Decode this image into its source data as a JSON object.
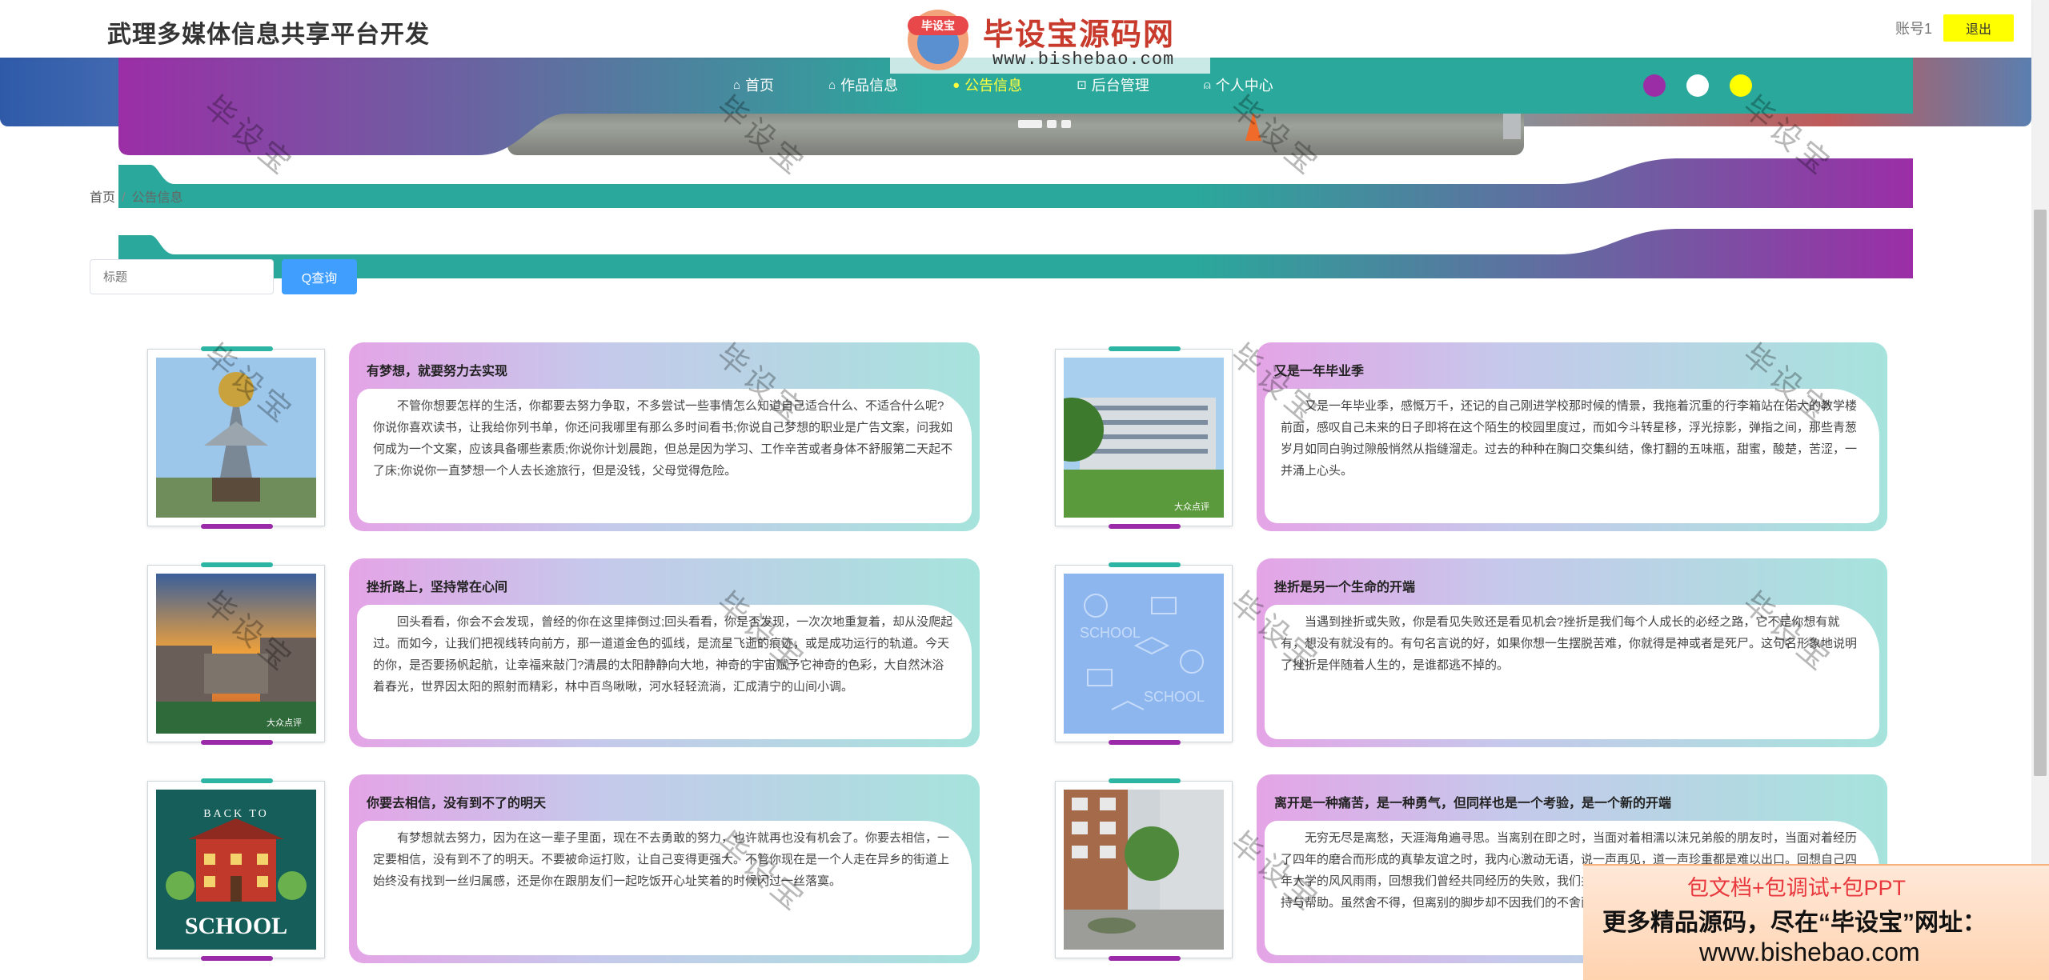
{
  "header": {
    "title": "武理多媒体信息共享平台开发",
    "account": "账号1",
    "logout": "退出"
  },
  "nav": {
    "items": [
      {
        "icon": "⌂",
        "label": "首页",
        "active": false
      },
      {
        "icon": "⌂",
        "label": "作品信息",
        "active": false
      },
      {
        "icon": "●",
        "label": "公告信息",
        "active": true
      },
      {
        "icon": "⊡",
        "label": "后台管理",
        "active": false
      },
      {
        "icon": "⍝",
        "label": "个人中心",
        "active": false
      }
    ],
    "theme_colors": [
      "#9b2ea6",
      "#ffffff",
      "#ffff00"
    ]
  },
  "logo": {
    "badge": "毕设宝",
    "text": "毕设宝源码网",
    "url": "www.bishebao.com"
  },
  "breadcrumb": {
    "home": "首页",
    "sep": "/",
    "current": "公告信息"
  },
  "search": {
    "placeholder": "标题",
    "button": "Q查询"
  },
  "watermark": "毕设宝",
  "cards": [
    {
      "title": "有梦想，就要努力去实现",
      "body": "不管你想要怎样的生活，你都要去努力争取，不多尝试一些事情怎么知道自己适合什么、不适合什么呢?你说你喜欢读书，让我给你列书单，你还问我哪里有那么多时间看书;你说自己梦想的职业是广告文案，问我如何成为一个文案，应该具备哪些素质;你说你计划晨跑，但总是因为学习、工作辛苦或者身体不舒服第二天起不了床;你说你一直梦想一个人去长途旅行，但是没钱，父母觉得危险。"
    },
    {
      "title": "又是一年毕业季",
      "body": "又是一年毕业季，感慨万千，还记的自己刚进学校那时候的情景，我拖着沉重的行李箱站在偌大的教学楼前面，感叹自己未来的日子即将在这个陌生的校园里度过，而如今斗转星移，浮光掠影，弹指之间，那些青葱岁月如同白驹过隙般悄然从指缝溜走。过去的种种在胸口交集纠结，像打翻的五味瓶，甜蜜，酸楚，苦涩，一并涌上心头。"
    },
    {
      "title": "挫折路上，坚持常在心间",
      "body": "回头看看，你会不会发现，曾经的你在这里摔倒过;回头看看，你是否发现，一次次地重复着，却从没爬起过。而如今，让我们把视线转向前方，那一道道金色的弧线，是流星飞逝的痕迹，或是成功运行的轨道。今天的你，是否要扬帆起航，让幸福来敲门?清晨的太阳静静向大地，神奇的宇宙赋予它神奇的色彩，大自然沐浴着春光，世界因太阳的照射而精彩，林中百鸟啾啾，河水轻轻流淌，汇成清宁的山间小调。"
    },
    {
      "title": "挫折是另一个生命的开端",
      "body": "当遇到挫折或失败，你是看见失败还是看见机会?挫折是我们每个人成长的必经之路，它不是你想有就有，想没有就没有的。有句名言说的好，如果你想一生摆脱苦难，你就得是神或者是死尸。这句名形象地说明了挫折是伴随着人生的，是谁都逃不掉的。"
    },
    {
      "title": "你要去相信，没有到不了的明天",
      "body": "有梦想就去努力，因为在这一辈子里面，现在不去勇敢的努力，也许就再也没有机会了。你要去相信，一定要相信，没有到不了的明天。不要被命运打败，让自己变得更强大。不管你现在是一个人走在异乡的街道上始终没有找到一丝归属感，还是你在跟朋友们一起吃饭开心址笑着的时候闪过一丝落寞。"
    },
    {
      "title": "离开是一种痛苦，是一种勇气，但同样也是一个考验，是一个新的开端",
      "body": "无穷无尽是离愁，天涯海角遍寻思。当离别在即之时，当面对着相濡以沫兄弟般的朋友时，当面对着经历了四年的磨合而形成的真挚友谊之时，我内心激动无语，说一声再见，道一声珍重都是难以出口。回想自己四年大学的风风雨雨，回想我们曾经共同经历的失败，我们共同享受的成功，我们在共处的日子里，给予的大支持与帮助。虽然舍不得，但离别的脚步却不因我们的不舍而停下。"
    }
  ],
  "card_images": [
    "statue-photo",
    "campus-building-photo",
    "sunset-campus-photo",
    "school-pattern-photo",
    "back-to-school-illustration",
    "courtyard-photo"
  ],
  "image_captions": {
    "dianping": "大众点评",
    "back_to": "BACK TO",
    "school": "SCHOOL"
  },
  "ad": {
    "line1": "包文档+包调试+包PPT",
    "line2": "更多精品源码，尽在“毕设宝”网址：",
    "line3": "www.bishebao.com"
  }
}
